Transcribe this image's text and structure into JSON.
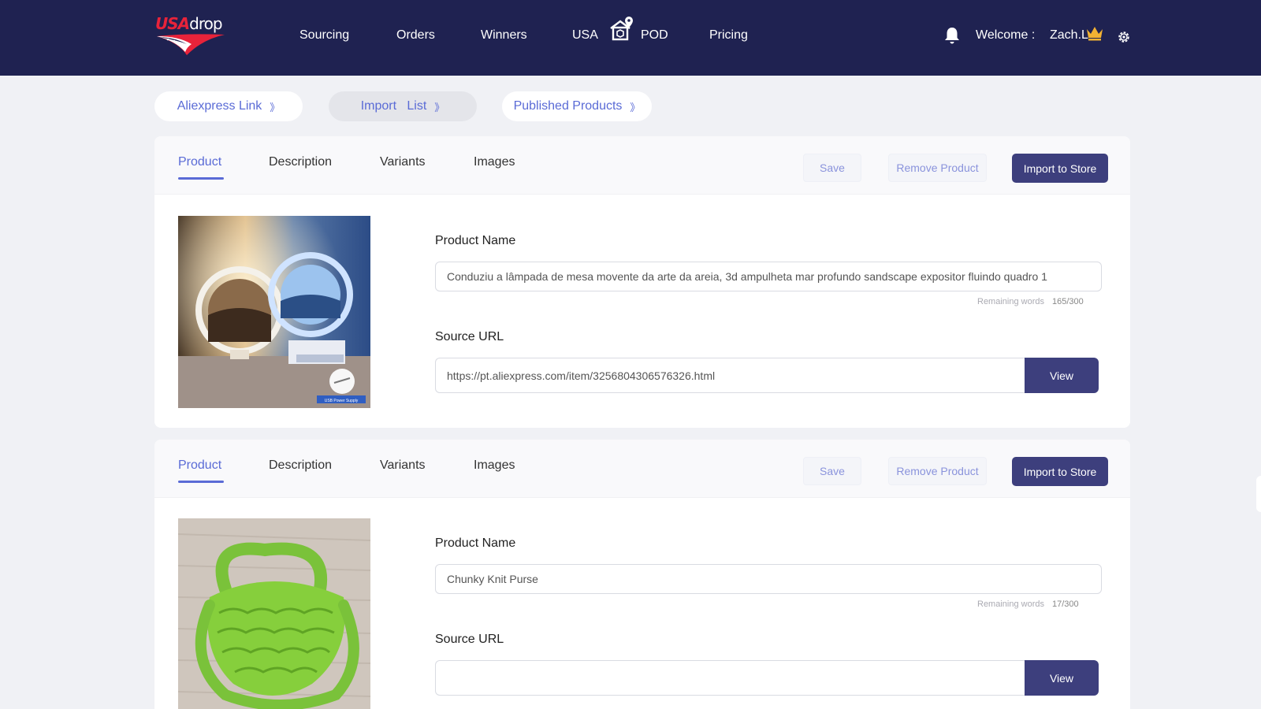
{
  "brand": {
    "usa": "USA",
    "drop": "drop",
    "colors": {
      "navy": "#1f2251",
      "accent": "#5a6bd6",
      "button": "#3d3f7d",
      "red": "#e8233a"
    }
  },
  "nav": {
    "items": [
      "Sourcing",
      "Orders",
      "Winners",
      "USA",
      "POD",
      "Pricing"
    ],
    "pod_icon": "house-location-icon",
    "bell_icon": "bell-icon",
    "welcome": "Welcome :",
    "user": "Zach.L",
    "crown_icon": "crown-icon",
    "settings_icon": "gear-icon"
  },
  "breadcrumb": [
    {
      "label": "Aliexpress Link",
      "chev": "》"
    },
    {
      "label": "Import   List",
      "chev": "》"
    },
    {
      "label": "Published Products",
      "chev": "》"
    }
  ],
  "products": [
    {
      "tabs": [
        "Product",
        "Description",
        "Variants",
        "Images"
      ],
      "save": "Save",
      "remove": "Remove Product",
      "import": "Import to Store",
      "name_label": "Product Name",
      "name": "Conduziu a lâmpada de mesa movente da arte da areia, 3d ampulheta mar profundo sandscape expositor fluindo quadro 1",
      "remaining_label": "Remaining words",
      "remaining": "165/300",
      "url_label": "Source URL",
      "url": "https://pt.aliexpress.com/item/3256804306576326.html",
      "view": "View",
      "image_caption": "USB Power Supply"
    },
    {
      "tabs": [
        "Product",
        "Description",
        "Variants",
        "Images"
      ],
      "save": "Save",
      "remove": "Remove Product",
      "import": "Import to Store",
      "name_label": "Product Name",
      "name": "Chunky Knit Purse",
      "remaining_label": "Remaining words",
      "remaining": "17/300",
      "url_label": "Source URL",
      "url": "",
      "view": "View"
    }
  ]
}
